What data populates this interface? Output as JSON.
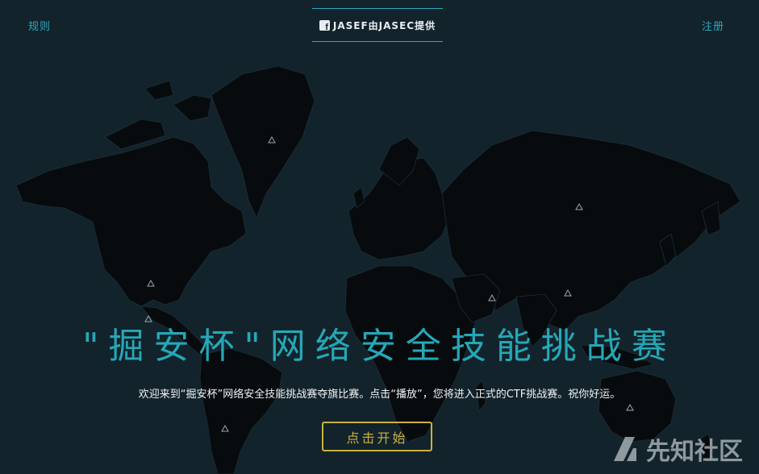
{
  "nav": {
    "rules": "规则",
    "register": "注册"
  },
  "brand": {
    "text": "JASEF由JASEC提供",
    "icon": "facebook-icon"
  },
  "hero": {
    "title": "\"掘安杯\"网络安全技能挑战赛",
    "subtitle": "欢迎来到“掘安杯”网络安全技能挑战赛夺旗比赛。点击“播放”，您将进入正式的CTF挑战赛。祝你好运。",
    "start_button": "点击开始"
  },
  "watermark": {
    "text": "先知社区"
  },
  "colors": {
    "background": "#13232b",
    "land": "#070b0e",
    "accent": "#2aa9bf",
    "button": "#c9b140"
  }
}
